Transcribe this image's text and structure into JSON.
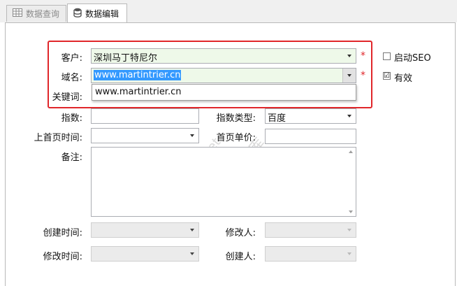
{
  "tabs": [
    {
      "label": "数据查询",
      "icon": "table-icon"
    },
    {
      "label": "数据编辑",
      "icon": "database-icon"
    }
  ],
  "form": {
    "customer": {
      "label": "客户:",
      "value": "深圳马丁特尼尔",
      "required": "*"
    },
    "domain": {
      "label": "域名:",
      "value": "www.martintrier.cn",
      "required": "*"
    },
    "domain_dropdown": {
      "options": [
        "www.martintrier.cn"
      ]
    },
    "keyword": {
      "label": "关键词:"
    },
    "index": {
      "label": "指数:",
      "value": ""
    },
    "index_type": {
      "label": "指数类型:",
      "value": "百度"
    },
    "first_page_time": {
      "label": "上首页时间:",
      "value": ""
    },
    "first_page_price": {
      "label": "首页单价:",
      "value": ""
    },
    "remark": {
      "label": "备注:",
      "value": ""
    },
    "create_time": {
      "label": "创建时间:"
    },
    "modifier": {
      "label": "修改人:"
    },
    "modify_time": {
      "label": "修改时间:"
    },
    "creator": {
      "label": "创建人:"
    },
    "enable_seo": {
      "label": "启动SEO",
      "checked": false
    },
    "valid": {
      "label": "有效",
      "checked": true,
      "mark": "☑"
    }
  },
  "watermark": {
    "line1": "www.cs  net",
    "line2": "开发框架文库"
  },
  "colors": {
    "highlight": "#e0262a",
    "selection": "#3399ff",
    "field_green": "#eef9e9"
  }
}
